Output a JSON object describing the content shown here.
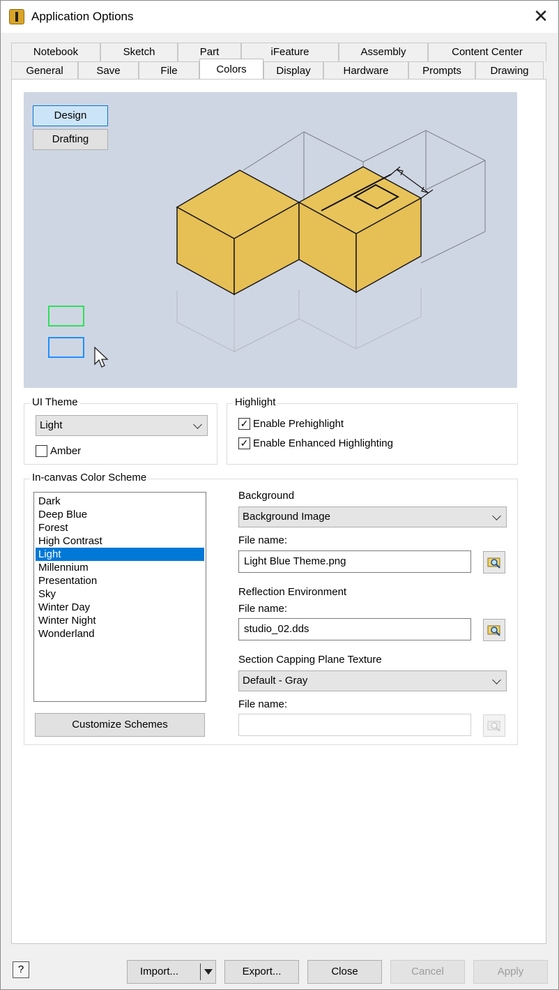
{
  "window": {
    "title": "Application Options",
    "close_glyph": "✕"
  },
  "tabs": {
    "row1": [
      "Notebook",
      "Sketch",
      "Part",
      "iFeature",
      "Assembly",
      "Content Center"
    ],
    "row2": [
      "General",
      "Save",
      "File",
      "Colors",
      "Display",
      "Hardware",
      "Prompts",
      "Drawing"
    ],
    "active": "Colors"
  },
  "preview": {
    "design_label": "Design",
    "drafting_label": "Drafting",
    "selected": "Design",
    "model_color": "#e6bf55",
    "background_color": "#cfd6e3",
    "prehighlight_color": "#2ee05a",
    "highlight_color": "#1e90ff"
  },
  "ui_theme": {
    "label": "UI Theme",
    "value": "Light",
    "amber_label": "Amber",
    "amber_checked": false
  },
  "highlight": {
    "label": "Highlight",
    "prehighlight_label": "Enable Prehighlight",
    "prehighlight_checked": true,
    "enhanced_label": "Enable Enhanced Highlighting",
    "enhanced_checked": true
  },
  "color_scheme": {
    "label": "In-canvas Color Scheme",
    "items": [
      "Dark",
      "Deep Blue",
      "Forest",
      "High Contrast",
      "Light",
      "Millennium",
      "Presentation",
      "Sky",
      "Winter Day",
      "Winter Night",
      "Wonderland"
    ],
    "selected": "Light",
    "customize_label": "Customize Schemes"
  },
  "background": {
    "label": "Background",
    "value": "Background Image",
    "file_label": "File name:",
    "file_value": "Light Blue Theme.png"
  },
  "reflection": {
    "label": "Reflection Environment",
    "file_label": "File name:",
    "file_value": "studio_02.dds"
  },
  "section_capping": {
    "label": "Section Capping Plane Texture",
    "value": "Default - Gray",
    "file_label": "File name:",
    "file_value": ""
  },
  "footer": {
    "help_glyph": "?",
    "import_label": "Import...",
    "export_label": "Export...",
    "close_label": "Close",
    "cancel_label": "Cancel",
    "apply_label": "Apply"
  },
  "accent_color": "#0078d7"
}
